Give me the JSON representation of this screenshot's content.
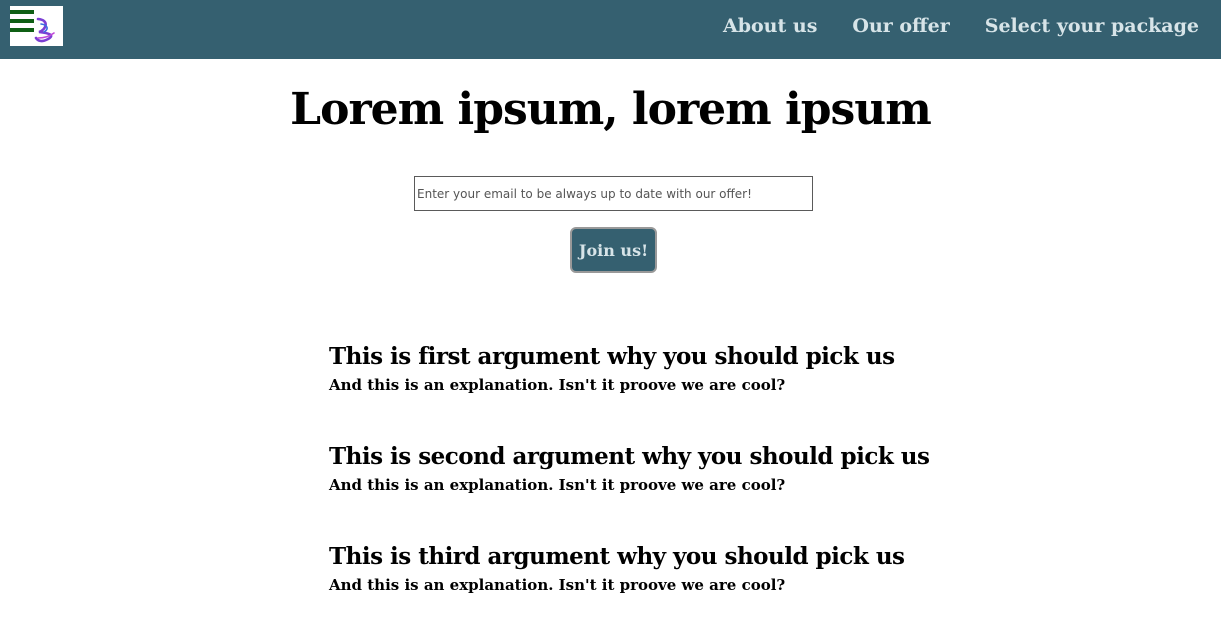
{
  "header": {
    "background_color": "#356070",
    "logo_icon": "ribbon-logo-icon",
    "menu_icon": "hamburger-menu-icon",
    "nav": [
      {
        "label": "About us"
      },
      {
        "label": "Our offer"
      },
      {
        "label": "Select your package"
      }
    ]
  },
  "hero": {
    "title": "Lorem ipsum, lorem ipsum"
  },
  "signup": {
    "email_placeholder": "Enter your email to be always up to date with our offer!",
    "email_value": "",
    "button_label": "Join us!"
  },
  "arguments": [
    {
      "title": "This is first argument why you should pick us",
      "text": "And this is an explanation. Isn't it proove we are cool?"
    },
    {
      "title": "This is second argument why you should pick us",
      "text": "And this is an explanation. Isn't it proove we are cool?"
    },
    {
      "title": "This is third argument why you should pick us",
      "text": "And this is an explanation. Isn't it proove we are cool?"
    }
  ]
}
